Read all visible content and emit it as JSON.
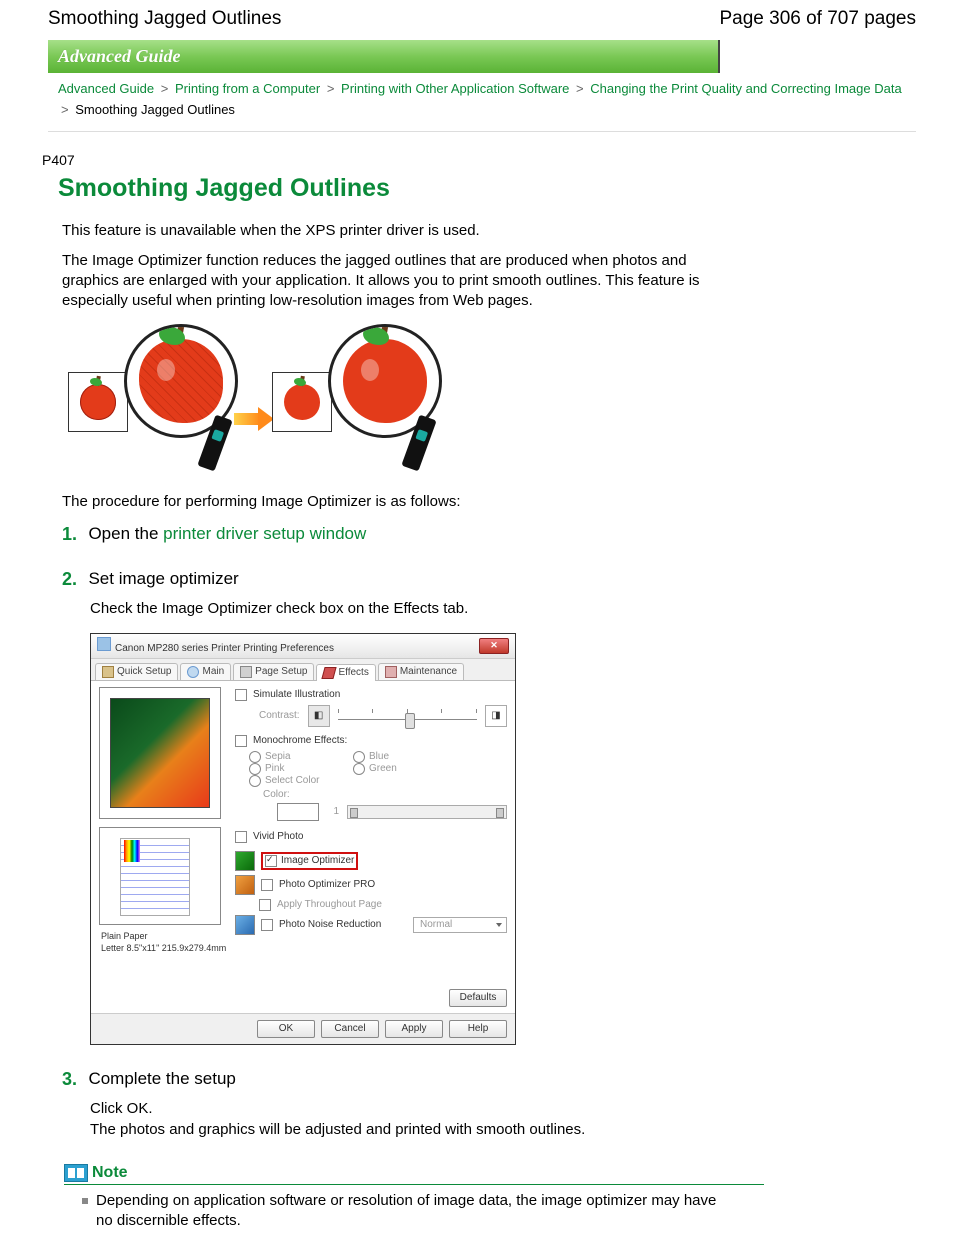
{
  "header": {
    "title": "Smoothing Jagged Outlines",
    "page_label": "Page 306 of 707 pages"
  },
  "banner": "Advanced Guide",
  "breadcrumbs": {
    "c1": "Advanced Guide",
    "c2": "Printing from a Computer",
    "c3": "Printing with Other Application Software",
    "c4": "Changing the Print Quality and Correcting Image Data",
    "c5": "Smoothing Jagged Outlines"
  },
  "doc_code": "P407",
  "h1": "Smoothing Jagged Outlines",
  "intro1": "This feature is unavailable when the XPS printer driver is used.",
  "intro2": "The Image Optimizer function reduces the jagged outlines that are produced when photos and graphics are enlarged with your application. It allows you to print smooth outlines. This feature is especially useful when printing low-resolution images from Web pages.",
  "procedures_intro": "The procedure for performing Image Optimizer is as follows:",
  "steps": {
    "s1": {
      "num": "1.",
      "pre": "Open the ",
      "link": "printer driver setup window"
    },
    "s2": {
      "num": "2.",
      "title": "Set image optimizer",
      "body": "Check the Image Optimizer check box on the Effects tab."
    },
    "s3": {
      "num": "3.",
      "title": "Complete the setup",
      "body1": "Click OK.",
      "body2": "The photos and graphics will be adjusted and printed with smooth outlines."
    }
  },
  "dialog": {
    "title": "Canon MP280 series Printer Printing Preferences",
    "tabs": {
      "quick": "Quick Setup",
      "main": "Main",
      "page": "Page Setup",
      "effects": "Effects",
      "maint": "Maintenance"
    },
    "simulate": "Simulate Illustration",
    "contrast": "Contrast:",
    "mono_label": "Monochrome Effects:",
    "mono": {
      "sepia": "Sepia",
      "blue": "Blue",
      "pink": "Pink",
      "green": "Green",
      "select": "Select Color",
      "color": "Color:",
      "value": "1"
    },
    "vivid": "Vivid Photo",
    "img_opt": "Image Optimizer",
    "pro": "Photo Optimizer PRO",
    "apply_throughout": "Apply Throughout Page",
    "noise": "Photo Noise Reduction",
    "noise_val": "Normal",
    "media1": "Plain Paper",
    "media2": "Letter 8.5\"x11\" 215.9x279.4mm",
    "defaults": "Defaults",
    "ok": "OK",
    "cancel": "Cancel",
    "apply": "Apply",
    "help": "Help"
  },
  "note": {
    "title": "Note",
    "item": "Depending on application software or resolution of image data, the image optimizer may have no discernible effects."
  }
}
